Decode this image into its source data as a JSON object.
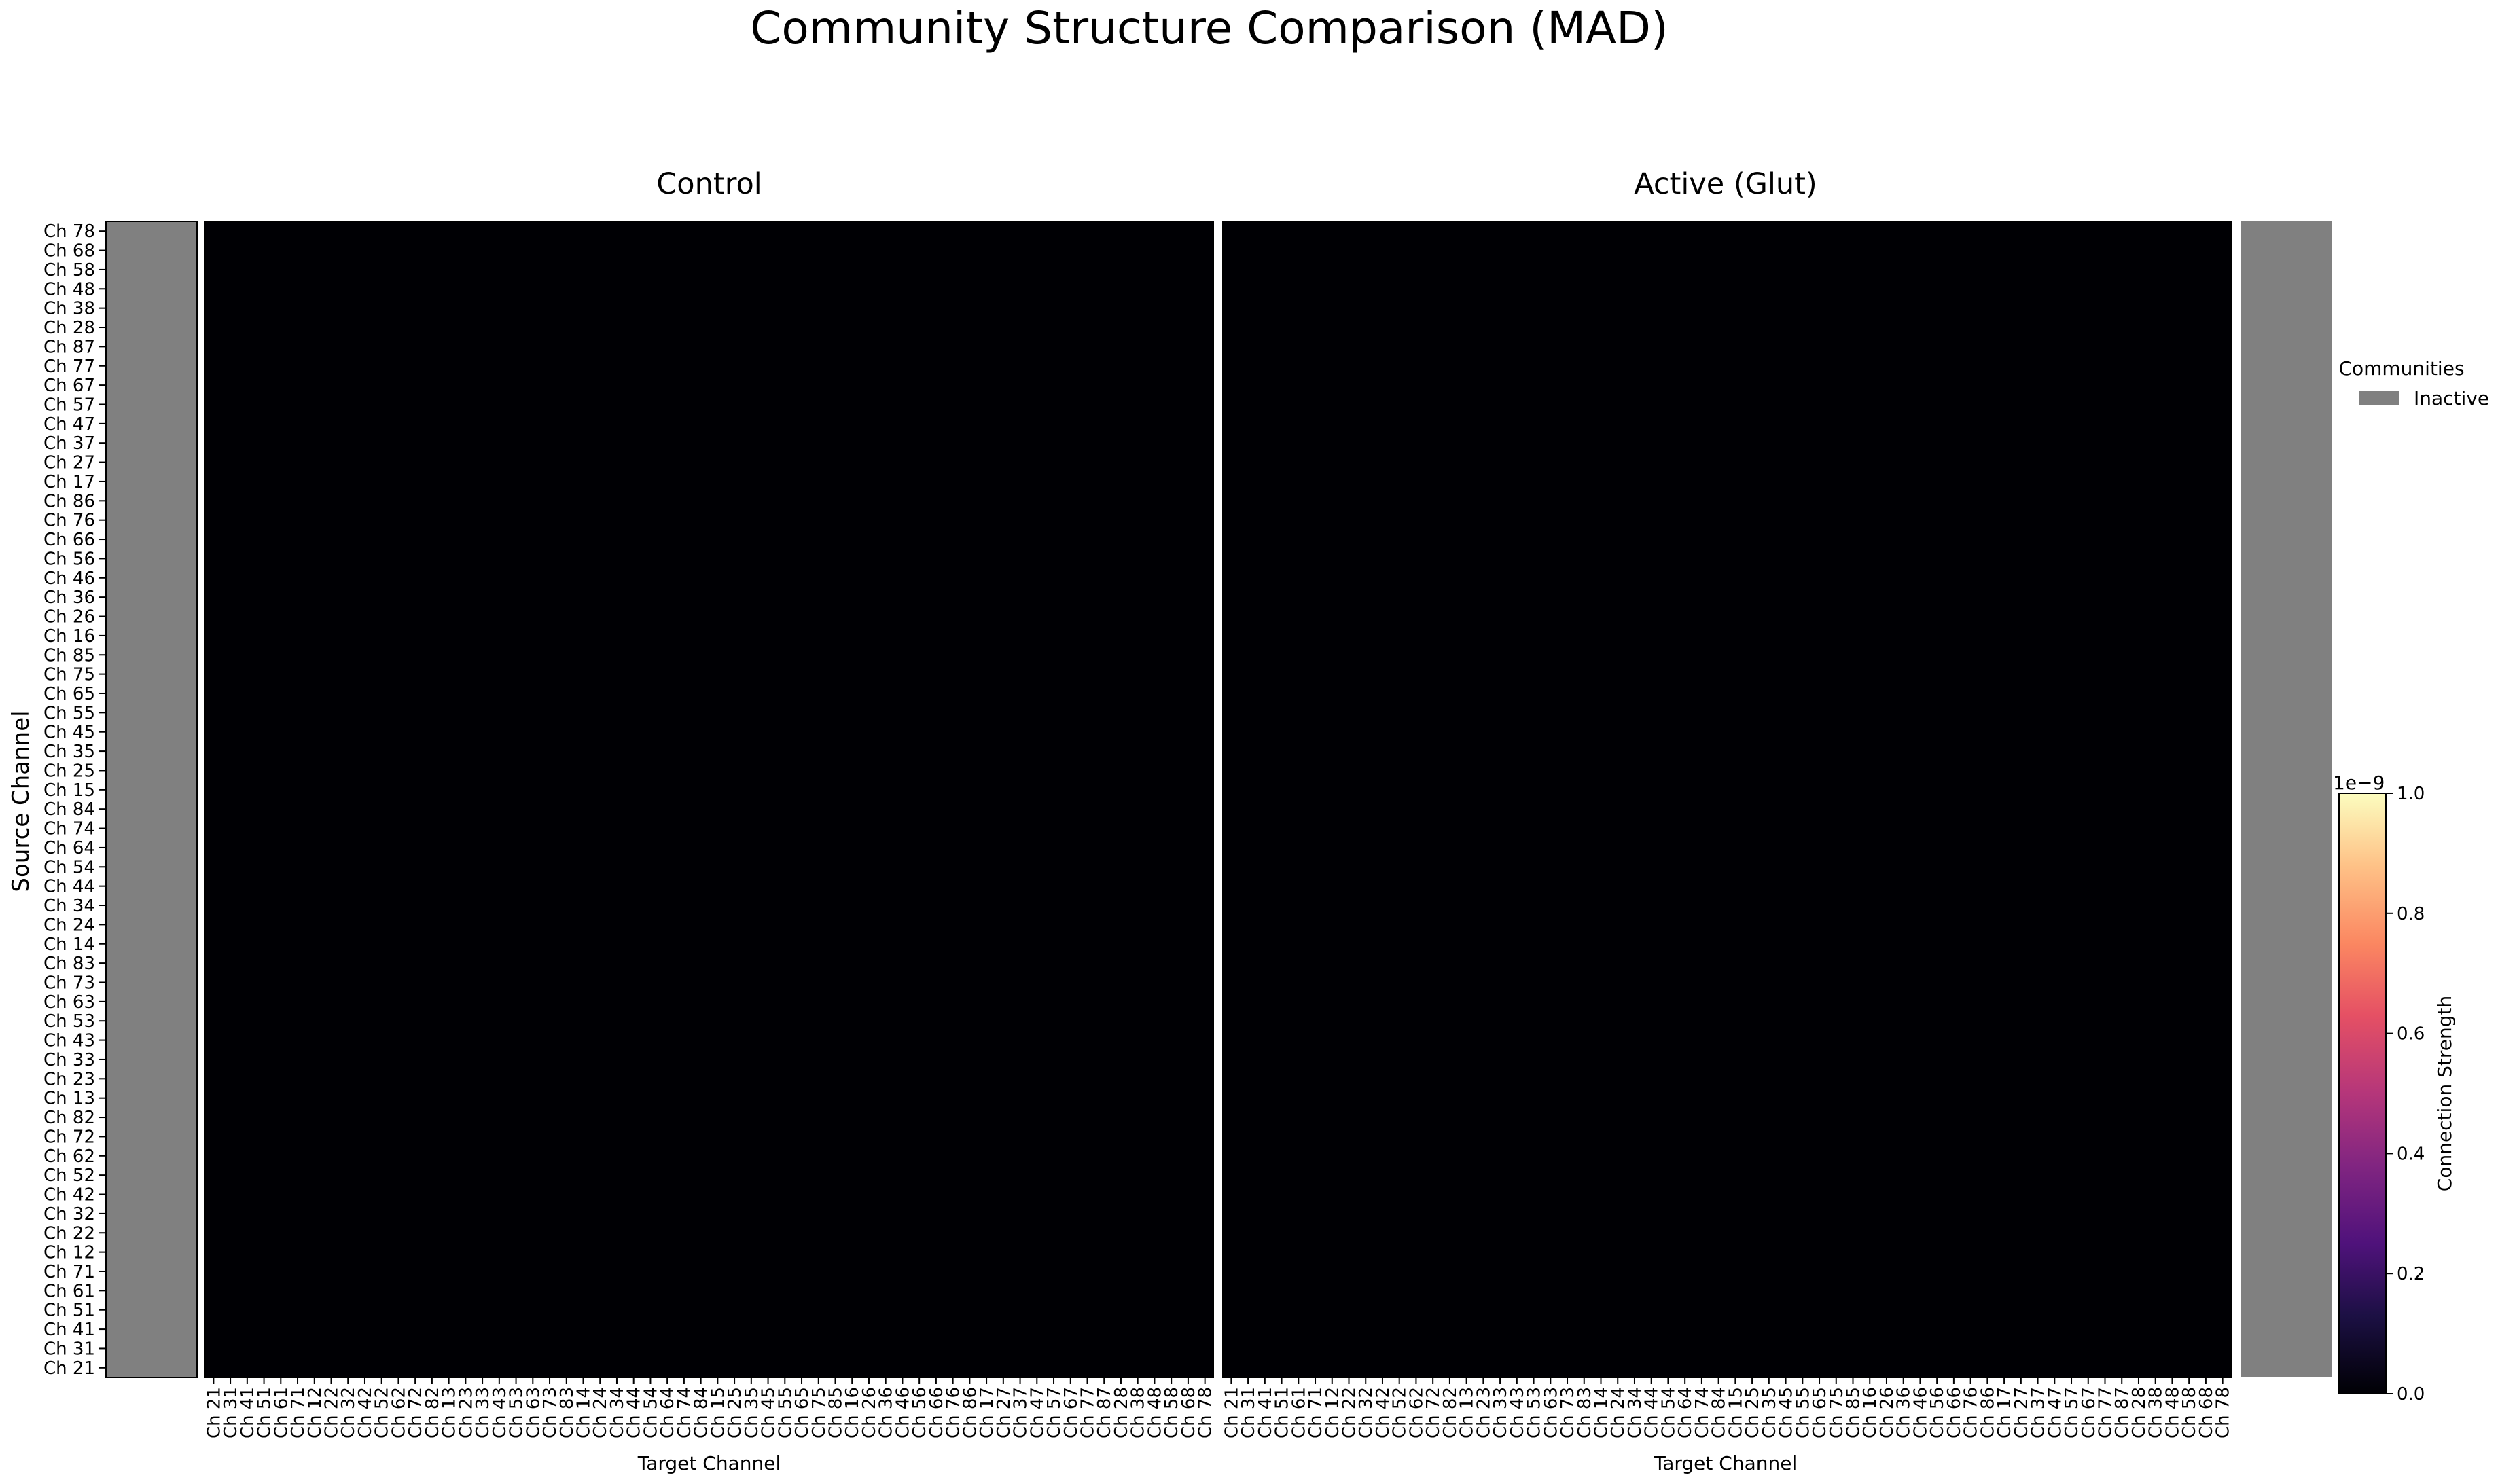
{
  "chart_data": {
    "type": "heatmap",
    "title": "Community Structure Comparison (MAD)",
    "panels": [
      {
        "title": "Control",
        "xlabel": "Target Channel",
        "ylabel": "Source Channel",
        "value": 0
      },
      {
        "title": "Active (Glut)",
        "xlabel": "Target Channel",
        "ylabel": "",
        "value": 0
      }
    ],
    "channels": [
      "Ch 21",
      "Ch 31",
      "Ch 41",
      "Ch 51",
      "Ch 61",
      "Ch 71",
      "Ch 12",
      "Ch 22",
      "Ch 32",
      "Ch 42",
      "Ch 52",
      "Ch 62",
      "Ch 72",
      "Ch 82",
      "Ch 13",
      "Ch 23",
      "Ch 33",
      "Ch 43",
      "Ch 53",
      "Ch 63",
      "Ch 73",
      "Ch 83",
      "Ch 14",
      "Ch 24",
      "Ch 34",
      "Ch 44",
      "Ch 54",
      "Ch 64",
      "Ch 74",
      "Ch 84",
      "Ch 15",
      "Ch 25",
      "Ch 35",
      "Ch 45",
      "Ch 55",
      "Ch 65",
      "Ch 75",
      "Ch 85",
      "Ch 16",
      "Ch 26",
      "Ch 36",
      "Ch 46",
      "Ch 56",
      "Ch 66",
      "Ch 76",
      "Ch 86",
      "Ch 17",
      "Ch 27",
      "Ch 37",
      "Ch 47",
      "Ch 57",
      "Ch 67",
      "Ch 77",
      "Ch 87",
      "Ch 28",
      "Ch 38",
      "Ch 48",
      "Ch 58",
      "Ch 68",
      "Ch 78"
    ],
    "communities": {
      "title": "Communities",
      "items": [
        {
          "label": "Inactive",
          "color": "#808080"
        }
      ]
    },
    "colorbar": {
      "label": "Connection Strength",
      "offset_label": "1e−9",
      "colormap": "magma",
      "range": [
        0,
        1.0
      ],
      "ticks": [
        "0.0",
        "0.2",
        "0.4",
        "0.6",
        "0.8",
        "1.0"
      ]
    },
    "cell_color": "#000004",
    "community_bar_color": "#808080"
  }
}
